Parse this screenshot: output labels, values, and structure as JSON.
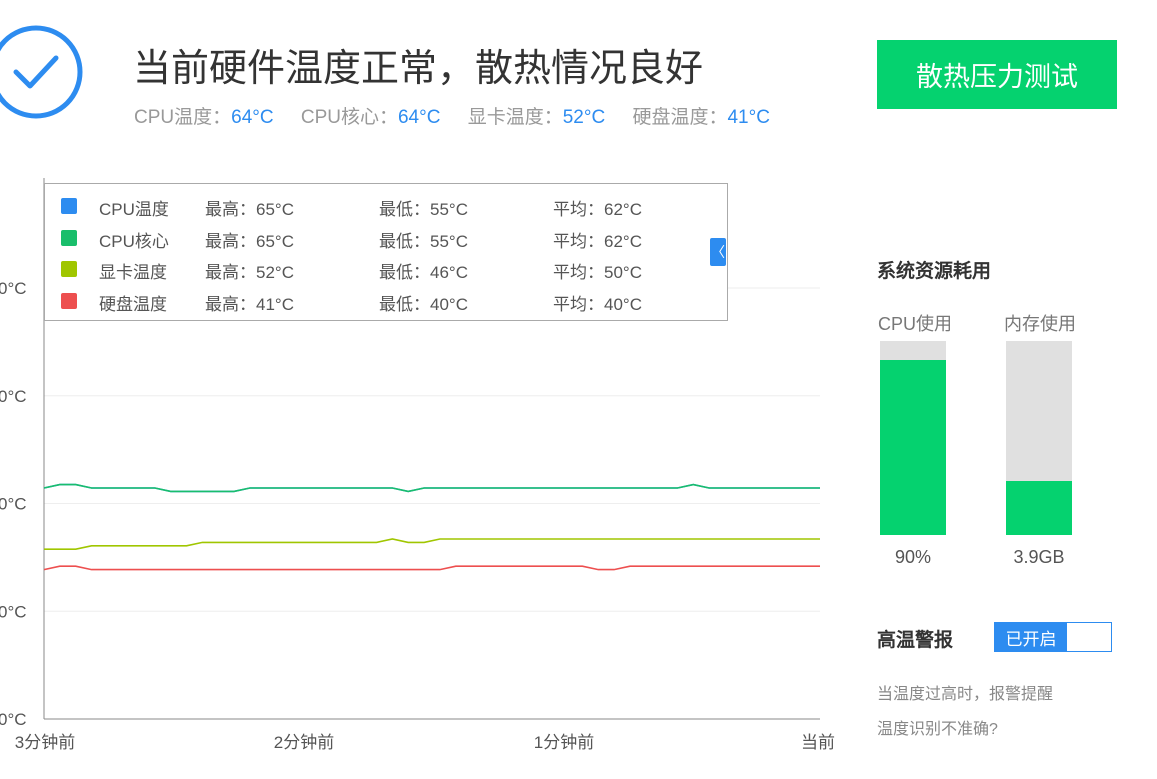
{
  "header": {
    "title": "当前硬件温度正常，散热情况良好",
    "stats": [
      {
        "label": "CPU温度：",
        "value": "64°C"
      },
      {
        "label": "CPU核心：",
        "value": "64°C"
      },
      {
        "label": "显卡温度：",
        "value": "52°C"
      },
      {
        "label": "硬盘温度：",
        "value": "41°C"
      }
    ],
    "stress_button": "散热压力测试",
    "status_icon": "check-circle-icon"
  },
  "chart_data": {
    "type": "line",
    "y_tick_labels": [
      "0°C",
      "0°C",
      "0°C",
      "0°C",
      "0°C"
    ],
    "x_tick_labels": [
      "3分钟前",
      "2分钟前",
      "1分钟前",
      "当前"
    ],
    "series": [
      {
        "name": "CPU温度",
        "color": "#2d8cf0",
        "values": [
          64,
          65,
          65,
          64,
          64,
          64,
          64,
          64,
          63,
          63,
          63,
          63,
          63,
          64,
          64,
          64,
          64,
          64,
          64,
          64,
          64,
          64,
          64,
          63,
          64,
          64,
          64,
          64,
          64,
          64,
          64,
          64,
          64,
          64,
          64,
          64,
          64,
          64,
          64,
          64,
          64,
          65,
          64,
          64,
          64,
          64,
          64,
          64,
          64,
          64
        ]
      },
      {
        "name": "CPU核心",
        "color": "#19be6b",
        "values": [
          64,
          65,
          65,
          64,
          64,
          64,
          64,
          64,
          63,
          63,
          63,
          63,
          63,
          64,
          64,
          64,
          64,
          64,
          64,
          64,
          64,
          64,
          64,
          63,
          64,
          64,
          64,
          64,
          64,
          64,
          64,
          64,
          64,
          64,
          64,
          64,
          64,
          64,
          64,
          64,
          64,
          65,
          64,
          64,
          64,
          64,
          64,
          64,
          64,
          64
        ]
      },
      {
        "name": "显卡温度",
        "color": "#a0c600",
        "values": [
          46,
          46,
          46,
          47,
          47,
          47,
          47,
          47,
          47,
          47,
          48,
          48,
          48,
          48,
          48,
          48,
          48,
          48,
          48,
          48,
          48,
          48,
          49,
          48,
          48,
          49,
          49,
          49,
          49,
          49,
          49,
          49,
          49,
          49,
          49,
          49,
          49,
          49,
          49,
          49,
          49,
          49,
          49,
          49,
          49,
          49,
          49,
          49,
          49,
          49
        ]
      },
      {
        "name": "硬盘温度",
        "color": "#ed4f4f",
        "values": [
          40,
          41,
          41,
          40,
          40,
          40,
          40,
          40,
          40,
          40,
          40,
          40,
          40,
          40,
          40,
          40,
          40,
          40,
          40,
          40,
          40,
          40,
          40,
          40,
          40,
          40,
          41,
          41,
          41,
          41,
          41,
          41,
          41,
          41,
          41,
          40,
          40,
          41,
          41,
          41,
          41,
          41,
          41,
          41,
          41,
          41,
          41,
          41,
          41,
          41
        ]
      }
    ],
    "legend": [
      {
        "name": "CPU温度",
        "color": "#2d8cf0",
        "max": "最高：65°C",
        "min": "最低：55°C",
        "avg": "平均：62°C"
      },
      {
        "name": "CPU核心",
        "color": "#19be6b",
        "max": "最高：65°C",
        "min": "最低：55°C",
        "avg": "平均：62°C"
      },
      {
        "name": "显卡温度",
        "color": "#a0c600",
        "max": "最高：52°C",
        "min": "最低：46°C",
        "avg": "平均：50°C"
      },
      {
        "name": "硬盘温度",
        "color": "#ed4f4f",
        "max": "最高：41°C",
        "min": "最低：40°C",
        "avg": "平均：40°C"
      }
    ],
    "legend_collapse_glyph": "〈",
    "grid": true
  },
  "resources": {
    "title": "系统资源耗用",
    "cpu": {
      "label": "CPU使用",
      "value": "90%",
      "fraction": 0.9
    },
    "memory": {
      "label": "内存使用",
      "value": "3.9GB",
      "fraction": 0.28
    }
  },
  "alert": {
    "title": "高温警报",
    "toggle_label": "已开启",
    "hint": "当温度过高时，报警提醒",
    "link": "温度识别不准确?"
  },
  "colors": {
    "accent": "#2d8cf0",
    "green": "#05d26f"
  }
}
